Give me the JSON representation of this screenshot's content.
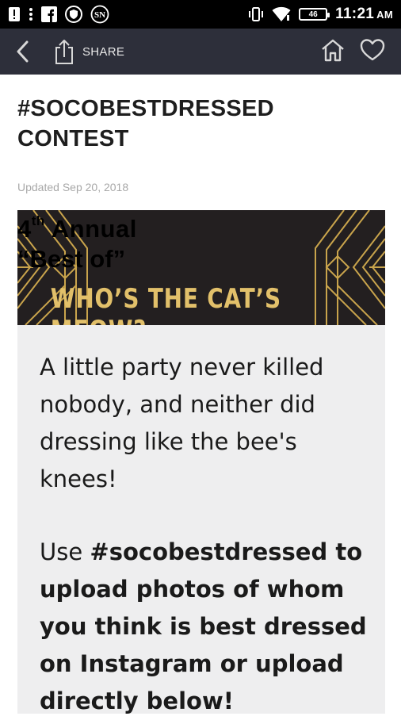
{
  "status_bar": {
    "time": "11:21",
    "ampm": "AM",
    "battery": "46",
    "left_icons": [
      "alert-icon",
      "more-vertical-icon",
      "facebook-icon",
      "shield-icon",
      "sn-icon"
    ],
    "right_icons": [
      "vibrate-icon",
      "wifi-icon",
      "battery-icon"
    ]
  },
  "toolbar": {
    "share_label": "SHARE",
    "icons": [
      "back-arrow-icon",
      "share-icon",
      "home-icon",
      "heart-icon"
    ]
  },
  "article": {
    "title": "#SOCOBESTDRESSED CONTEST",
    "updated": "Updated Sep 20, 2018"
  },
  "banner": {
    "line1_number": "4",
    "line1_suffix": "th",
    "line1_rest": " Annual",
    "line2": "“Best of”",
    "line3": "WHO’S THE CAT’S MEOW?",
    "accent_color": "#e2c06a",
    "background_color": "#231f20"
  },
  "body": {
    "paragraph1": "A little party never killed nobody, and neither did dressing like the bee's knees!",
    "paragraph2_prefix": "Use ",
    "paragraph2_bold": "#socobestdressed to upload photos of whom you think is best dressed on Instagram or upload directly below!"
  },
  "colors": {
    "status_bar": "#000000",
    "toolbar": "#2d2f3a",
    "textbox": "#eeeeef"
  }
}
